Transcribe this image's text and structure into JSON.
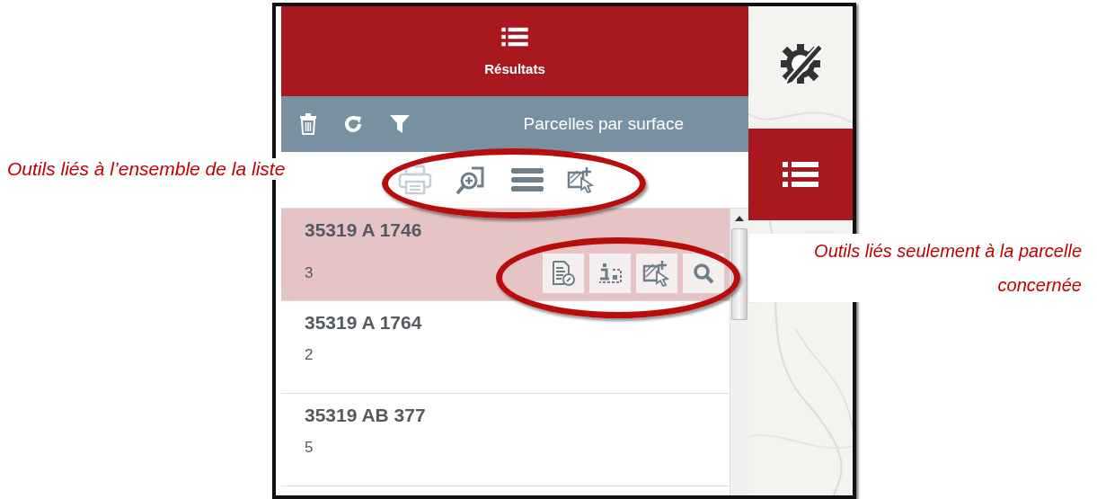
{
  "header": {
    "title": "Résultats"
  },
  "toolbar": {
    "title": "Parcelles par surface",
    "tools": [
      {
        "kind": "delete"
      },
      {
        "kind": "refresh"
      },
      {
        "kind": "filter"
      }
    ]
  },
  "list_tools": [
    {
      "kind": "print",
      "disabled": true
    },
    {
      "kind": "zoom",
      "disabled": false
    },
    {
      "kind": "list",
      "disabled": false
    },
    {
      "kind": "select",
      "disabled": false
    }
  ],
  "results": [
    {
      "parcel": "35319 A 1746",
      "value": "3",
      "selected": true
    },
    {
      "parcel": "35319 A 1764",
      "value": "2",
      "selected": false
    },
    {
      "parcel": "35319 AB 377",
      "value": "5",
      "selected": false
    }
  ],
  "row_tools": [
    {
      "kind": "report"
    },
    {
      "kind": "info"
    },
    {
      "kind": "select"
    },
    {
      "kind": "search"
    }
  ],
  "side_tabs": [
    {
      "kind": "settings",
      "selected": false
    },
    {
      "kind": "results",
      "selected": true
    }
  ],
  "annotations": [
    {
      "text": "Outils liés à l’ensemble de la liste"
    },
    {
      "text": "Outils liés seulement à la parcelle concernée"
    }
  ]
}
